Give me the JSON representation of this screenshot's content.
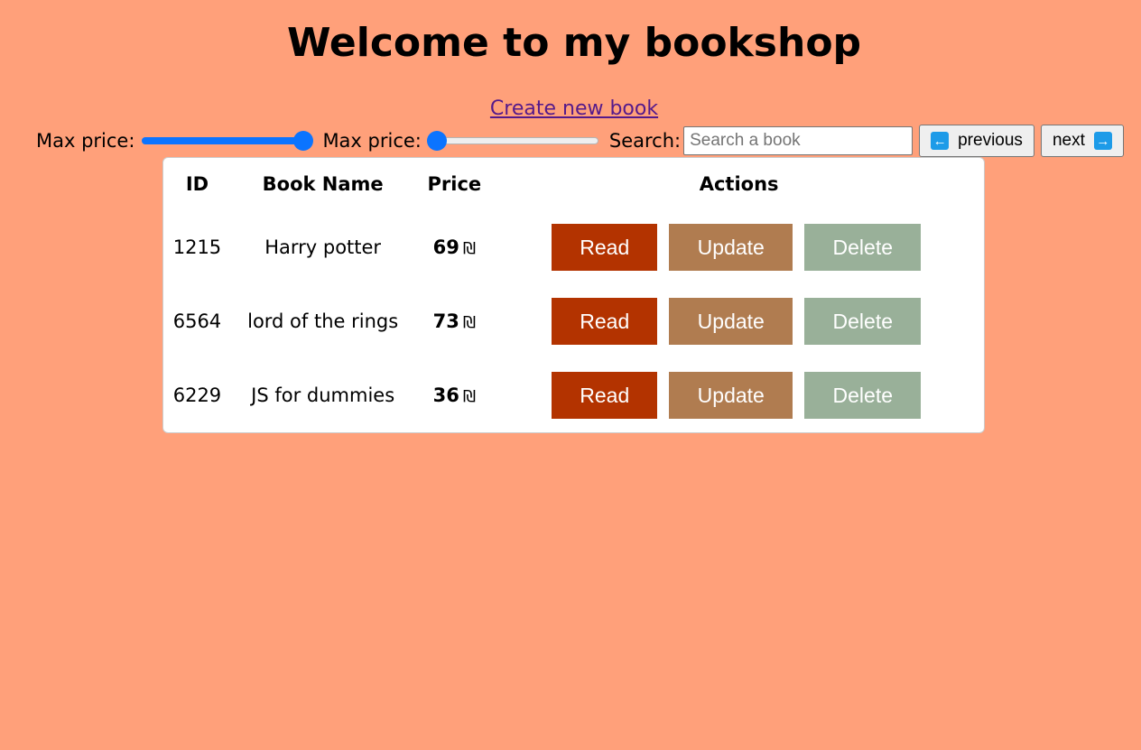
{
  "header": {
    "title": "Welcome to my bookshop",
    "create_link": "Create new book"
  },
  "filters": {
    "max_price_label_1": "Max price:",
    "max_price_label_2": "Max price:",
    "slider_1_level": 1.0,
    "slider_2_level": 0.0,
    "search_label": "Search:",
    "search_placeholder": "Search a book",
    "search_value": "",
    "previous_label": "previous",
    "next_label": "next",
    "previous_icon": "arrow-left-icon",
    "next_icon": "arrow-right-icon"
  },
  "table": {
    "columns": [
      "ID",
      "Book Name",
      "Price",
      "Actions"
    ],
    "currency": "₪",
    "rows": [
      {
        "id": "1215",
        "name": "Harry potter",
        "price": "69"
      },
      {
        "id": "6564",
        "name": "lord of the rings",
        "price": "73"
      },
      {
        "id": "6229",
        "name": "JS for dummies",
        "price": "36"
      }
    ],
    "actions": {
      "read": "Read",
      "update": "Update",
      "delete": "Delete"
    }
  },
  "colors": {
    "background": "#ffa07a",
    "slider_accent": "#0b74ff",
    "read_button": "#b33300",
    "update_button": "#b07c50",
    "delete_button": "#99b099",
    "link": "#551a8b"
  }
}
